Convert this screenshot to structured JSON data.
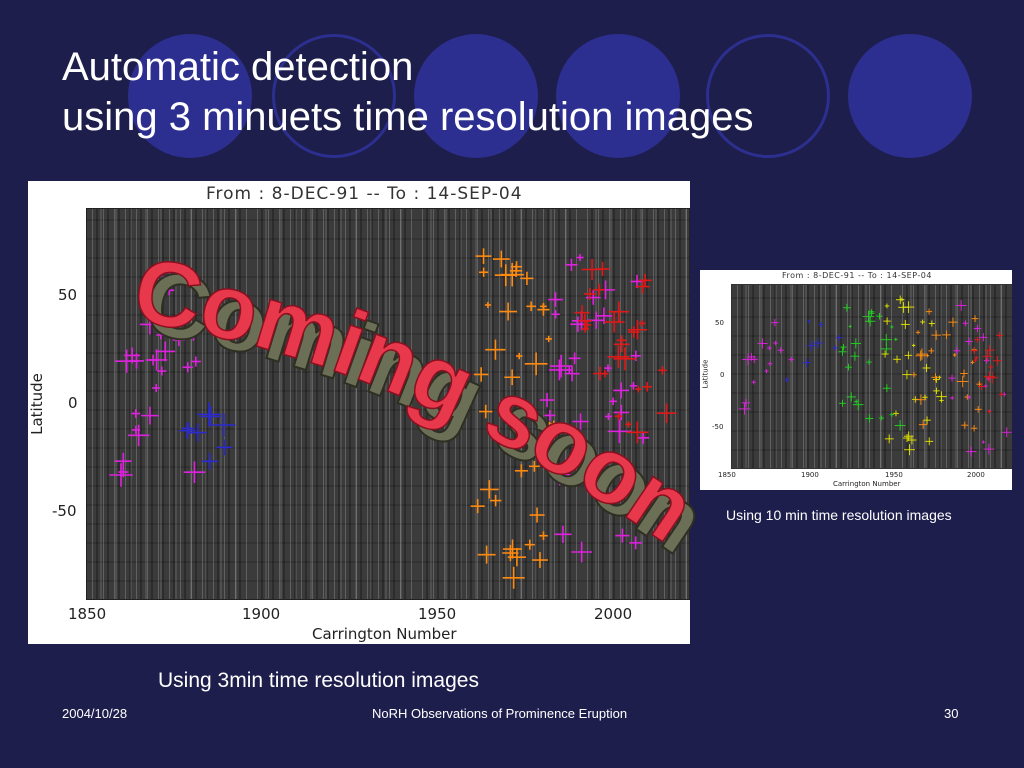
{
  "slide": {
    "title_line1": "Automatic detection",
    "title_line2": "using 3 minuets time resolution images",
    "overlay_text": "Coming soon!!",
    "footer": {
      "date": "2004/10/28",
      "center": "NoRH Observations of Prominence Eruption",
      "page": "30"
    }
  },
  "colors": {
    "background": "#1e1e4c",
    "circle": "#2c2f8f",
    "overlay_fill": "#e8384c",
    "overlay_shadow": "#6b6f55"
  },
  "main_plot": {
    "header": "From :  8-DEC-91  --  To : 14-SEP-04",
    "ylabel": "Latitude",
    "xlabel": "Carrington Number",
    "yticks": [
      "50",
      "0",
      "-50"
    ],
    "xticks": [
      "1850",
      "1900",
      "1950",
      "2000"
    ],
    "caption": "Using 3min time resolution images"
  },
  "small_plot": {
    "header": "From :  8-DEC-91  --  To : 14-SEP-04",
    "ylabel": "Latitude",
    "xlabel": "Carrington Number",
    "yticks": [
      "50",
      "0",
      "-50"
    ],
    "xticks": [
      "1850",
      "1900",
      "1950",
      "2000"
    ],
    "caption": "Using 10 min time resolution images"
  }
}
